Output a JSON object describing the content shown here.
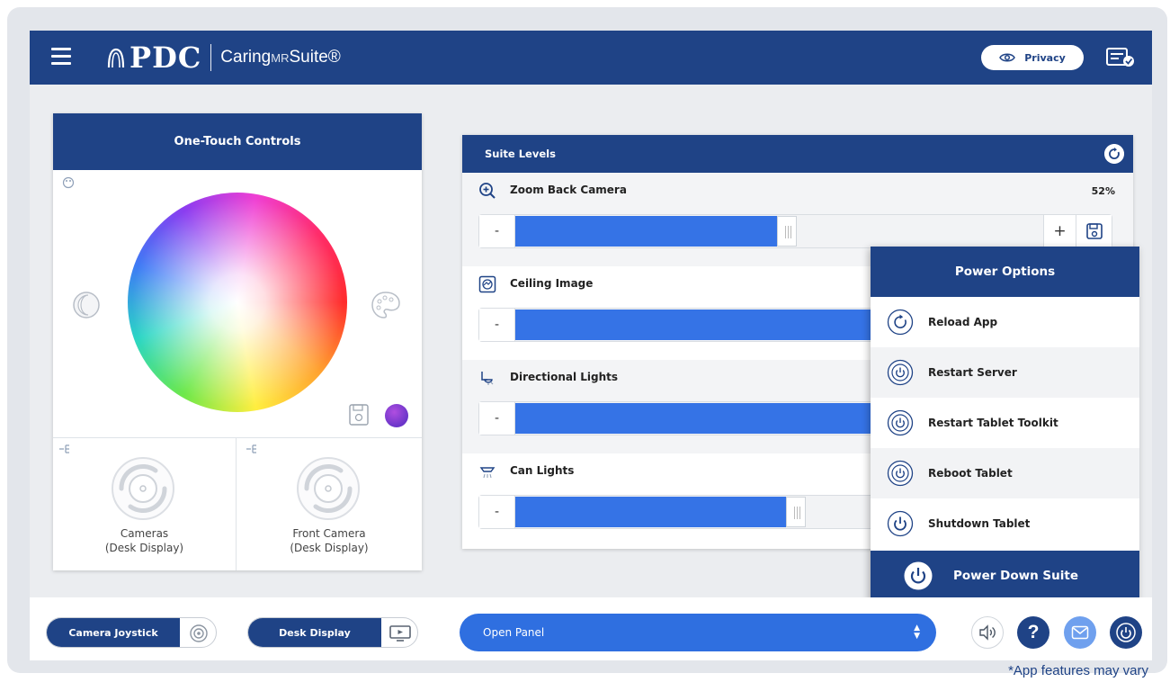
{
  "header": {
    "brand_logo": "PDC",
    "brand_suite_prefix": "Caring",
    "brand_suite_mr": "MR",
    "brand_suite_suffix": "Suite®",
    "privacy_label": "Privacy"
  },
  "one_touch": {
    "title": "One-Touch Controls",
    "cells": [
      {
        "line1": "Cameras",
        "line2": "(Desk Display)"
      },
      {
        "line1": "Front Camera",
        "line2": "(Desk Display)"
      }
    ],
    "selected_color": "#7b3ed6"
  },
  "suite_levels": {
    "title": "Suite Levels",
    "rows": [
      {
        "label": "Zoom Back Camera",
        "value_text": "52%",
        "level": 0.52,
        "icon": "zoom-in-icon"
      },
      {
        "label": "Ceiling Image",
        "icon": "ceiling-image-icon"
      },
      {
        "label": "Directional Lights",
        "icon": "directional-light-icon"
      },
      {
        "label": "Can Lights",
        "icon": "can-light-icon",
        "level": 0.53
      }
    ],
    "minus": "-",
    "plus": "+"
  },
  "power_options": {
    "title": "Power Options",
    "items": [
      {
        "label": "Reload App",
        "icon": "reload-icon"
      },
      {
        "label": "Restart Server",
        "icon": "restart-icon"
      },
      {
        "label": "Restart Tablet Toolkit",
        "icon": "restart-icon"
      },
      {
        "label": "Reboot Tablet",
        "icon": "restart-icon"
      },
      {
        "label": "Shutdown Tablet",
        "icon": "power-icon"
      }
    ],
    "footer": "Power Down Suite"
  },
  "bottom": {
    "camera_joystick": "Camera Joystick",
    "desk_display": "Desk Display",
    "open_panel": "Open Panel"
  },
  "footnote": "*App features may vary",
  "colors": {
    "brand_blue": "#1f4386",
    "accent_blue": "#3573e6",
    "mail_blue": "#6fa0ee"
  }
}
